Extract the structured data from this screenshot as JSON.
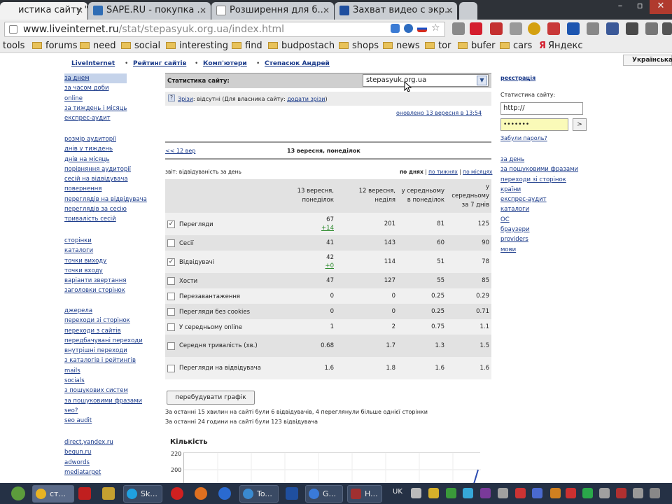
{
  "browser": {
    "tabs": [
      {
        "label": "истика сайту \"C...",
        "active": true
      },
      {
        "label": "SAPE.RU - покупка ...",
        "active": false
      },
      {
        "label": "Розширення для б...",
        "active": false
      },
      {
        "label": "Захват видео с экр...",
        "active": false
      }
    ],
    "url_host": "www.liveinternet.ru",
    "url_path": "/stat/stepasyuk.org.ua/index.html",
    "bookmarks": [
      "tools",
      "forums",
      "need",
      "social",
      "interesting",
      "find",
      "budpostach",
      "shops",
      "news",
      "tor",
      "bufer",
      "cars",
      "Яндекс"
    ],
    "lang_badge": "Українська"
  },
  "topnav": [
    "LiveInternet",
    "Рейтинг сайтів",
    "Комп'ютери",
    "Степасюк Андрей"
  ],
  "left_nav": {
    "group1": [
      "за днем",
      "за часом доби",
      "online",
      "за тиждень і місяць",
      "експрес-аудит"
    ],
    "group2": [
      "розмір аудиторії",
      "днів у тиждень",
      "днів на місяць",
      "порівняння аудиторії",
      "сесій на відвідувача",
      "повернення",
      "переглядів на відвідувача",
      "переглядів за сесію",
      "тривалість сесій"
    ],
    "group3": [
      "сторінки",
      "каталоги",
      "точки виходу",
      "точки входу",
      "варіанти звертання",
      "заголовки сторінок"
    ],
    "group4": [
      "джерела",
      "переходи зі сторінок",
      "переходи з сайтів",
      "передбачувані переходи",
      "внутрішні переходи",
      "з каталогів і рейтингів",
      "mails",
      "socials",
      "з пошукових систем",
      "за пошуковими фразами",
      "seo?",
      "seo audit"
    ],
    "group5": [
      "direct.yandex.ru",
      "begun.ru",
      "adwords",
      "mediatarget"
    ]
  },
  "stats": {
    "label": "Статистика сайту:",
    "site": "stepasyuk.org.ua",
    "errors_link": "Зрізи",
    "errors_text": ": відсутні (Для власника сайту:",
    "errors_action": "додати зрізи",
    "errors_close": ")",
    "updated": "оновлено 13 вересня в 13:54",
    "prev_link": "<< 12 вер",
    "date": "13 вересня, понеділок",
    "table_title": "звіт: відвідуваність за день",
    "view_label": "по днях",
    "view_weeks": "по тижнях",
    "view_months": "по місяцях",
    "columns": [
      "13 вересня, понеділок",
      "12 вересня, неділя",
      "у середньому в понеділок",
      "у середньому за 7 днів"
    ],
    "rows": [
      {
        "name": "Перегляди",
        "checked": true,
        "v1": "67",
        "delta": "+14",
        "v2": "201",
        "v3": "81",
        "v4": "125"
      },
      {
        "name": "Сесії",
        "checked": false,
        "v1": "41",
        "delta": "",
        "v2": "143",
        "v3": "60",
        "v4": "90"
      },
      {
        "name": "Відвідувачі",
        "checked": true,
        "v1": "42",
        "delta": "+0",
        "v2": "114",
        "v3": "51",
        "v4": "78"
      },
      {
        "name": "Хости",
        "checked": false,
        "v1": "47",
        "delta": "",
        "v2": "127",
        "v3": "55",
        "v4": "85"
      },
      {
        "name": "Перезавантаження",
        "checked": false,
        "v1": "0",
        "delta": "",
        "v2": "0",
        "v3": "0.25",
        "v4": "0.29"
      },
      {
        "name": "Перегляди без cookies",
        "checked": false,
        "v1": "0",
        "delta": "",
        "v2": "0",
        "v3": "0.25",
        "v4": "0.71"
      },
      {
        "name": "У середньому online",
        "checked": false,
        "v1": "1",
        "delta": "",
        "v2": "2",
        "v3": "0.75",
        "v4": "1.1"
      },
      {
        "name": "Середня тривалість (хв.)",
        "checked": false,
        "v1": "0.68",
        "delta": "",
        "v2": "1.7",
        "v3": "1.3",
        "v4": "1.5"
      },
      {
        "name": "Перегляди на відвідувача",
        "checked": false,
        "v1": "1.6",
        "delta": "",
        "v2": "1.8",
        "v3": "1.6",
        "v4": "1.6"
      }
    ],
    "rebuild_label": "перебудувати графік",
    "summary1": "За останні 15 хвилин на сайті були 6 відвідувачів, 4 переглянули більше однієї сторінки",
    "summary2": "За останні 24 години на сайті були 123 відвідувача",
    "chart_title": "Кількість",
    "chart_ticks": [
      "220",
      "200"
    ]
  },
  "right": {
    "register": "реєстрація",
    "label": "Статистика сайту:",
    "url_value": "http://",
    "password_value": "•••••••",
    "go": ">",
    "forgot": "Забули пароль?",
    "links": [
      "за день",
      "за пошуковими фразами",
      "переходи зі сторінок",
      "країни",
      "експрес-аудит",
      "каталоги",
      "ОС",
      "браузери",
      "providers",
      "мови"
    ]
  },
  "taskbar": [
    "ст...",
    "Sk...",
    "To...",
    "G...",
    "H..."
  ],
  "tray_lang": "UK"
}
